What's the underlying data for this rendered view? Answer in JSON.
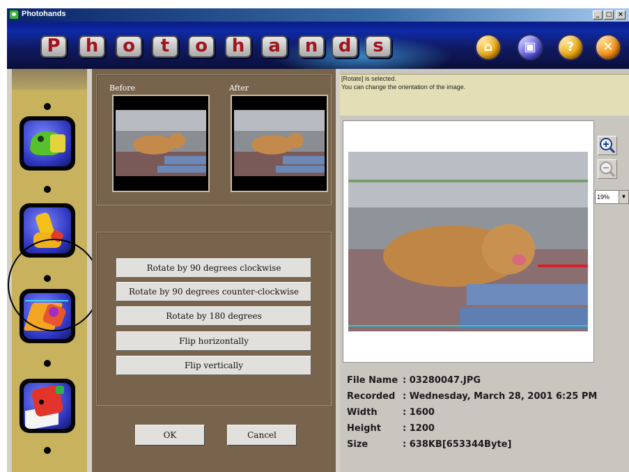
{
  "window": {
    "title": "Photohands",
    "minimize_glyph": "_",
    "maximize_glyph": "□",
    "close_glyph": "×"
  },
  "banner": {
    "letters": [
      "P",
      "h",
      "o",
      "t",
      "o",
      "h",
      "a",
      "n",
      "d",
      "s"
    ],
    "buttons": [
      {
        "name": "open",
        "icon": "folder-open-icon",
        "glyph": "⌂"
      },
      {
        "name": "save",
        "icon": "floppy-disk-icon",
        "glyph": "▣"
      },
      {
        "name": "help",
        "icon": "help-icon",
        "glyph": "?"
      },
      {
        "name": "close",
        "icon": "close-icon",
        "glyph": "✕"
      }
    ]
  },
  "toolbar": {
    "tools": [
      {
        "name": "chameleon",
        "icon": "chameleon-icon",
        "selected": false
      },
      {
        "name": "giraffe",
        "icon": "giraffe-icon",
        "selected": false
      },
      {
        "name": "cat",
        "icon": "cat-icon",
        "selected": true
      },
      {
        "name": "bird",
        "icon": "bird-icon",
        "selected": false
      }
    ]
  },
  "preview": {
    "before_label": "Before",
    "after_label": "After"
  },
  "rotate_options": [
    "Rotate by 90 degrees clockwise",
    "Rotate by 90 degrees counter-clockwise",
    "Rotate by 180 degrees",
    "Flip horizontally",
    "Flip vertically"
  ],
  "dialog_buttons": {
    "ok": "OK",
    "cancel": "Cancel"
  },
  "status": {
    "line1": "[Rotate] is selected.",
    "line2": "You can change the orientation of the image."
  },
  "zoom": {
    "level": "19%",
    "zoom_in_icon": "zoom-in-icon",
    "zoom_out_icon": "zoom-out-icon"
  },
  "file_info": {
    "file_name_label": "File Name",
    "file_name": ": 03280047.JPG",
    "recorded_label": "Recorded",
    "recorded": ": Wednesday, March 28, 2001 6:25 PM",
    "width_label": "Width",
    "width": ": 1600",
    "height_label": "Height",
    "height": ": 1200",
    "size_label": "Size",
    "size": ": 638KB[653344Byte]"
  },
  "colors": {
    "banner": "#101a63",
    "letter_face": "#c8c8c8",
    "letter_text": "#a3141c",
    "toolbar_strip": "#c8b25d",
    "dialog_bg": "#78644c",
    "status_bg": "#e4deb6"
  }
}
